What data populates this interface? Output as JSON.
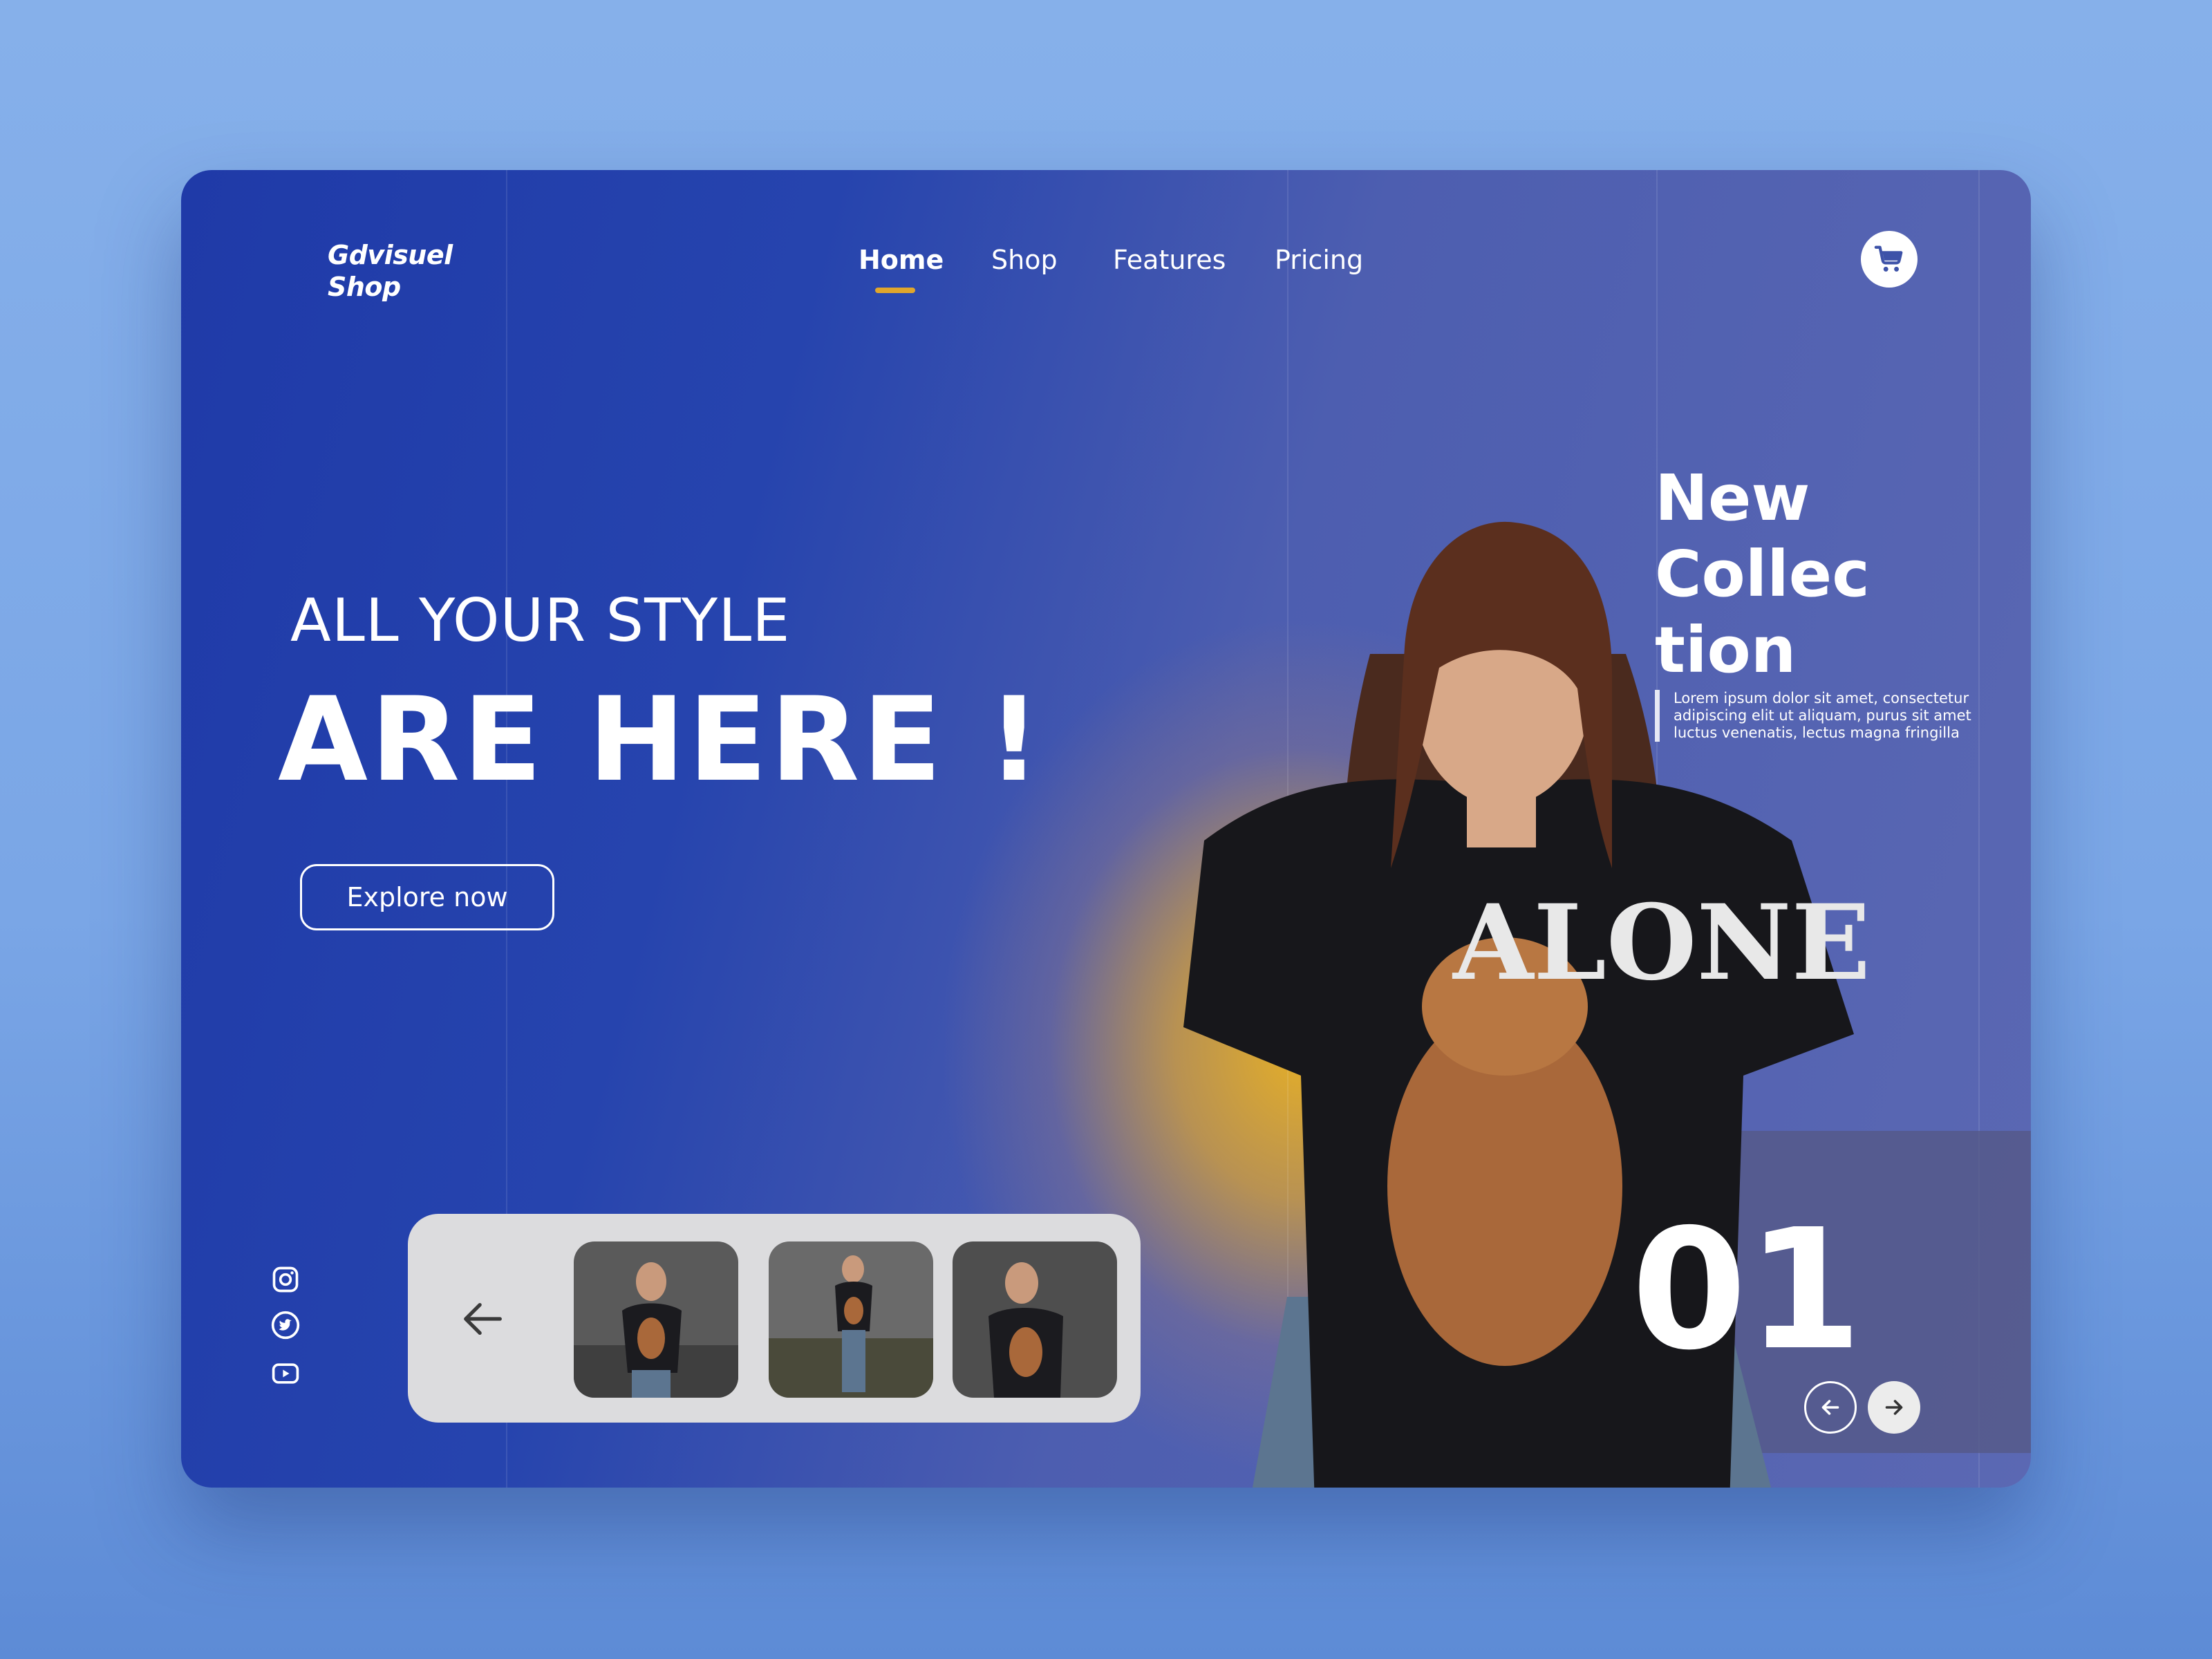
{
  "brand": {
    "line1": "Gdvisuel",
    "line2": "Shop"
  },
  "nav": {
    "items": [
      {
        "label": "Home",
        "active": true
      },
      {
        "label": "Shop",
        "active": false
      },
      {
        "label": "Features",
        "active": false
      },
      {
        "label": "Pricing",
        "active": false
      }
    ],
    "cart_icon": "cart-icon"
  },
  "hero": {
    "subtitle": "ALL YOUR STYLE",
    "title": "ARE HERE !",
    "cta_label": "Explore now"
  },
  "collection": {
    "title_lines": [
      "New",
      "Collec",
      "tion"
    ],
    "description": "Lorem ipsum dolor sit amet, consectetur adipiscing elit ut aliquam, purus sit amet luctus venenatis, lectus magna fringilla"
  },
  "slider": {
    "number": "01",
    "prev_icon": "arrow-left-icon",
    "next_icon": "arrow-right-icon"
  },
  "social": [
    "instagram-icon",
    "twitter-icon",
    "youtube-icon"
  ],
  "thumbnails": {
    "count": 3,
    "back_icon": "arrow-left-icon"
  },
  "colors": {
    "accent": "#e0a62c",
    "card_left": "#1f3aa8",
    "card_right": "#5b68b3",
    "glow": "#e4ae28",
    "thumb_bar": "#dcdcde"
  }
}
